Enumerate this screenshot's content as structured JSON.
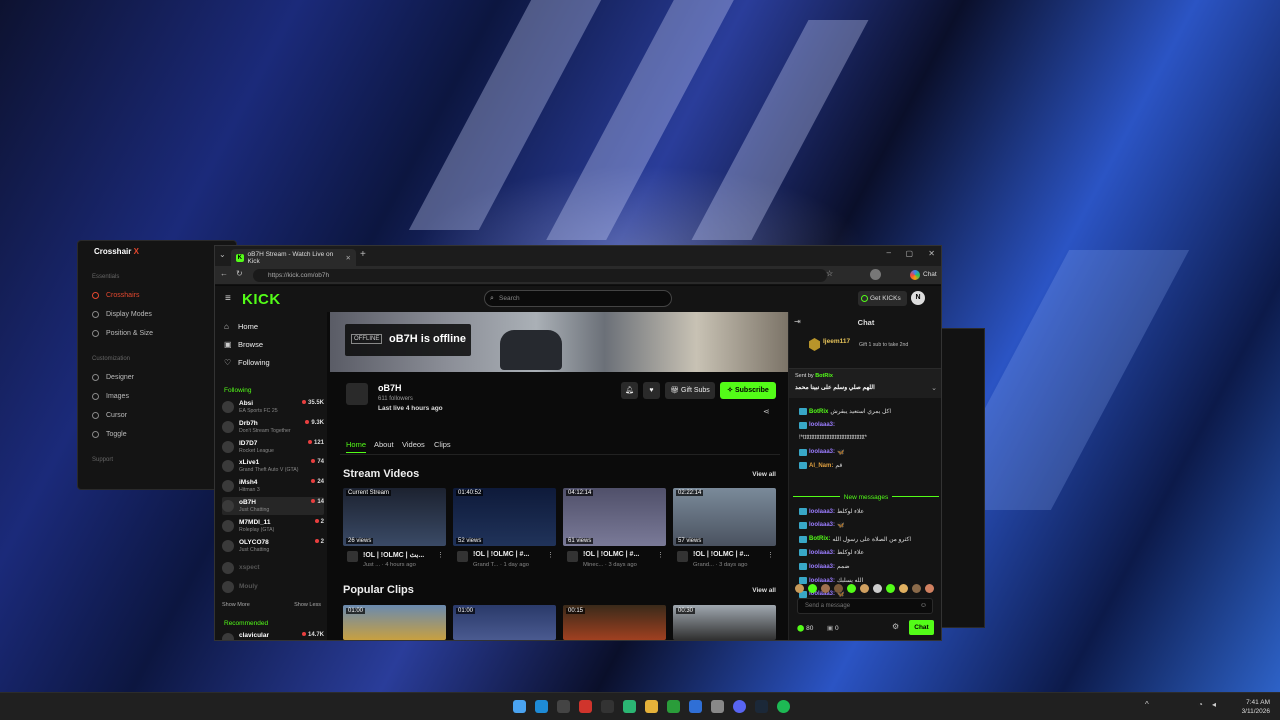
{
  "crosshair_app": {
    "title_main": "Crosshair",
    "title_accent": "X",
    "sections": {
      "essentials": "Essentials",
      "customization": "Customization",
      "support": "Support"
    },
    "items": [
      "Crosshairs",
      "Display Modes",
      "Position & Size",
      "Designer",
      "Images",
      "Cursor",
      "Toggle"
    ],
    "active_item": "Crosshairs"
  },
  "browser": {
    "tab_title": "oB7H Stream - Watch Live on Kick",
    "url": "https://kick.com/ob7h",
    "chat_label": "Chat"
  },
  "kick": {
    "logo": "KICK",
    "search_placeholder": "Search",
    "get_kicks": "Get KICKs",
    "user_initial": "N",
    "nav": [
      "Home",
      "Browse",
      "Following"
    ],
    "following_header": "Following",
    "following": [
      {
        "name": "Absi",
        "game": "EA Sports FC 25",
        "viewers": "35.5K"
      },
      {
        "name": "Drb7h",
        "game": "Don't Stream Together",
        "viewers": "9.3K"
      },
      {
        "name": "ID7D7",
        "game": "Rocket League",
        "viewers": "121"
      },
      {
        "name": "xLive1",
        "game": "Grand Theft Auto V (GTA)",
        "viewers": "74"
      },
      {
        "name": "iMsh4",
        "game": "Hitman 3",
        "viewers": "24"
      },
      {
        "name": "oB7H",
        "game": "Just Chatting",
        "viewers": "14"
      },
      {
        "name": "M7MDI_11",
        "game": "Roleplay (GTA)",
        "viewers": "2"
      },
      {
        "name": "OLYCO78",
        "game": "Just Chatting",
        "viewers": "2"
      }
    ],
    "offline_following": [
      "xspect",
      "Mouly"
    ],
    "show_more": "Show More",
    "show_less": "Show Less",
    "recommended_header": "Recommended",
    "recommended": [
      {
        "name": "clavicular",
        "viewers": "14.7K"
      }
    ],
    "channel": {
      "offline_tag": "OFFLINE",
      "offline_text": "oB7H is offline",
      "name": "oB7H",
      "followers": "611 followers",
      "last_live": "Last live 4 hours ago",
      "gift_subs": "Gift Subs",
      "subscribe": "Subscribe"
    },
    "tabs": [
      "Home",
      "About",
      "Videos",
      "Clips"
    ],
    "stream_videos_title": "Stream Videos",
    "view_all": "View all",
    "videos": [
      {
        "badge": "Current Stream",
        "views": "26 views",
        "title": "!OL | !OLMC | بث...",
        "meta": "Just ... · 4 hours ago"
      },
      {
        "badge": "01:40:52",
        "views": "52 views",
        "title": "!OL | !OLMC | #...",
        "meta": "Grand T... · 1 day ago"
      },
      {
        "badge": "04:12:14",
        "views": "61 views",
        "title": "!OL | !OLMC | #...",
        "meta": "Minec... · 3 days ago"
      },
      {
        "badge": "02:22:14",
        "views": "57 views",
        "title": "!OL | !OLMC | #...",
        "meta": "Grand... · 3 days ago"
      }
    ],
    "popular_clips_title": "Popular Clips",
    "clips": [
      {
        "duration": "01:00"
      },
      {
        "duration": "01:00"
      },
      {
        "duration": "00:15"
      },
      {
        "duration": "00:30"
      }
    ]
  },
  "chat": {
    "title": "Chat",
    "gifter_name": "Ijeem117",
    "gifter_note": "Gift 1 sub to take 2nd",
    "pinned_sent_by": "Sent by",
    "pinned_user": "BotRix",
    "pinned_text": "اللهم صلي وسلم على نبينا محمد",
    "messages_top": [
      {
        "user": "BotRix",
        "text": "اكل يمري استعيد يبقرش",
        "color": "#53fc18"
      },
      {
        "user": "loolaaa3:",
        "text": "",
        "color": "#9b7dff"
      },
      {
        "user": "",
        "text": "!*ttttttttttttttttttttttttttttttttttttt*",
        "color": "#ddd"
      },
      {
        "user": "loolaaa3:",
        "text": "🦋",
        "color": "#9b7dff"
      },
      {
        "user": "Al_Nam:",
        "text": "قم",
        "color": "#e0a040"
      }
    ],
    "new_messages": "New messages",
    "messages_new": [
      {
        "user": "loolaaa3:",
        "text": "علاء لوكلط",
        "color": "#9b7dff"
      },
      {
        "user": "loolaaa3:",
        "text": "🦋",
        "color": "#9b7dff"
      },
      {
        "user": "BotRix:",
        "text": "اكثرو من الصلاة على رسول الله",
        "color": "#53fc18"
      },
      {
        "user": "loolaaa3:",
        "text": "علاء لوكلط",
        "color": "#9b7dff"
      },
      {
        "user": "loolaaa3:",
        "text": "ضمم",
        "color": "#9b7dff"
      },
      {
        "user": "loolaaa3:",
        "text": "الله يسلبك",
        "color": "#9b7dff"
      },
      {
        "user": "loolaaa3:",
        "text": "🦋",
        "color": "#9b7dff"
      }
    ],
    "send_placeholder": "Send a message",
    "points": "80",
    "zero": "0",
    "chat_button": "Chat"
  },
  "taskbar": {
    "time": "7:41 AM",
    "date": "3/11/2026"
  },
  "colors": {
    "kick_green": "#53fc18",
    "accent_red": "#e4482f",
    "taskbar": "#202020"
  }
}
